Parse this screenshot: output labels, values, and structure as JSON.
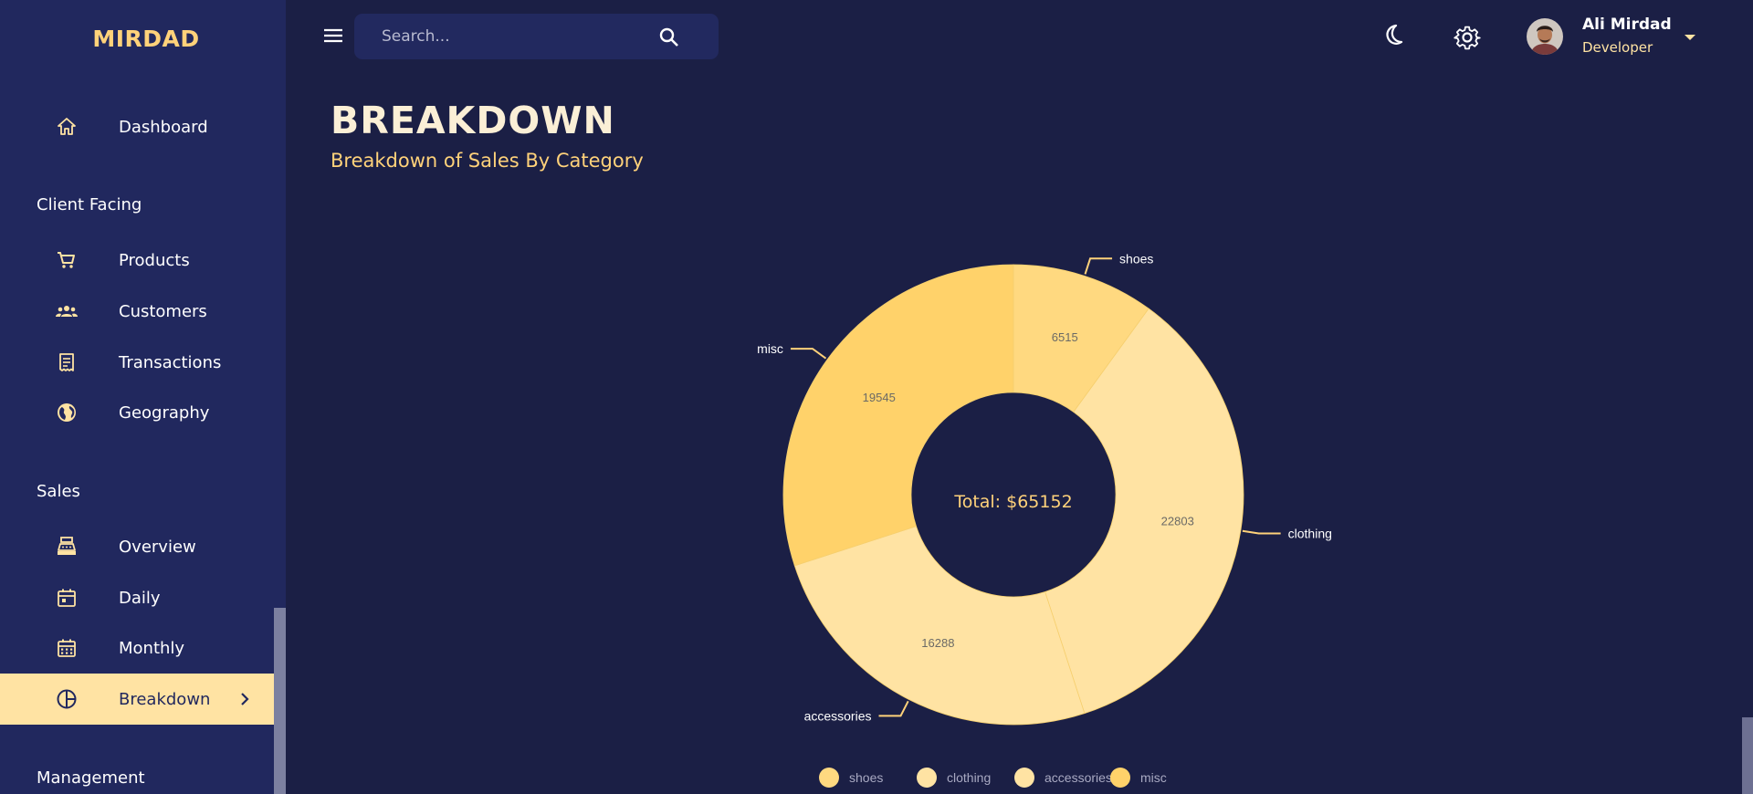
{
  "app": {
    "brand": "MIRDAD"
  },
  "sidebar": {
    "dashboard": "Dashboard",
    "sections": [
      {
        "title": "Client Facing",
        "items": [
          {
            "label": "Products",
            "icon": "shopping-cart-icon"
          },
          {
            "label": "Customers",
            "icon": "groups-icon"
          },
          {
            "label": "Transactions",
            "icon": "receipt-icon"
          },
          {
            "label": "Geography",
            "icon": "globe-icon"
          }
        ]
      },
      {
        "title": "Sales",
        "items": [
          {
            "label": "Overview",
            "icon": "point-of-sale-icon"
          },
          {
            "label": "Daily",
            "icon": "calendar-today-icon"
          },
          {
            "label": "Monthly",
            "icon": "calendar-month-icon"
          },
          {
            "label": "Breakdown",
            "icon": "pie-chart-icon",
            "active": true
          }
        ]
      },
      {
        "title": "Management"
      }
    ]
  },
  "topbar": {
    "search_placeholder": "Search...",
    "user": {
      "name": "Ali Mirdad",
      "role": "Developer"
    }
  },
  "page": {
    "title": "BREAKDOWN",
    "subtitle": "Breakdown of Sales By Category"
  },
  "colors": {
    "background": "#1b1f45",
    "sidebar": "#21285e",
    "accent": "#ffd27a",
    "active_bg": "#ffe3a3"
  },
  "chart_data": {
    "type": "pie",
    "center_text": "Total: $65152",
    "categories": [
      "shoes",
      "clothing",
      "accessories",
      "misc"
    ],
    "values": [
      6515,
      22803,
      16288,
      19545
    ],
    "colors": [
      "#ffd980",
      "#ffe3a3",
      "#ffe3a3",
      "#ffd26a"
    ],
    "legend": [
      "shoes",
      "clothing",
      "accessories",
      "misc"
    ],
    "legend_position": "bottom"
  }
}
